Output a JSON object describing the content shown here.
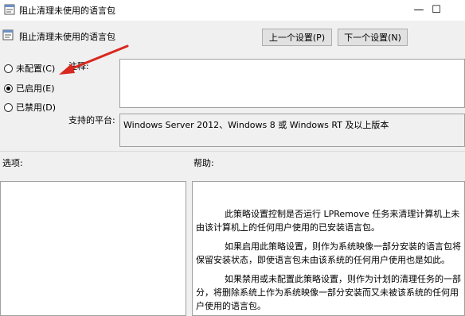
{
  "window": {
    "title": "阻止清理未使用的语言包",
    "minimize_glyph": "—",
    "maximize_glyph": "☐"
  },
  "header": {
    "policy_title": "阻止清理未使用的语言包",
    "prev_button": "上一个设置(P)",
    "next_button": "下一个设置(N)"
  },
  "state": {
    "options": [
      {
        "label": "未配置(C)",
        "checked": false
      },
      {
        "label": "已启用(E)",
        "checked": true
      },
      {
        "label": "已禁用(D)",
        "checked": false
      }
    ]
  },
  "comment": {
    "label": "注释:"
  },
  "platform": {
    "label": "支持的平台:",
    "value": "Windows Server 2012、Windows 8 或 Windows RT 及以上版本"
  },
  "sections": {
    "options_label": "选项:",
    "help_label": "帮助:"
  },
  "help": {
    "paragraphs": [
      "此策略设置控制是否运行 LPRemove 任务来清理计算机上未由该计算机上的任何用户使用的已安装语言包。",
      "如果启用此策略设置，则作为系统映像一部分安装的语言包将保留安装状态，即使语言包未由该系统的任何用户使用也是如此。",
      "如果禁用或未配置此策略设置，则作为计划的清理任务的一部分，将删除系统上作为系统映像一部分安装而又未被该系统的任何用户使用的语言包。"
    ]
  },
  "colors": {
    "annotation_arrow": "#d9281f",
    "window_bg": "#f0f0f0",
    "button_bg": "#e1e1e1"
  }
}
